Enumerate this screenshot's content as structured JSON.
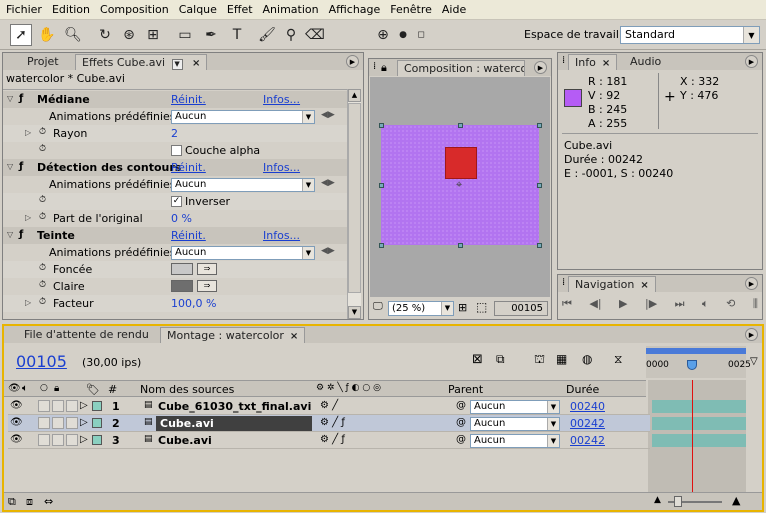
{
  "menu": [
    "Fichier",
    "Edition",
    "Composition",
    "Calque",
    "Effet",
    "Animation",
    "Affichage",
    "Fenêtre",
    "Aide"
  ],
  "workspace": {
    "label": "Espace de travail :",
    "value": "Standard"
  },
  "effects_panel": {
    "tab_project": "Projet",
    "tab_effects": "Effets Cube.avi",
    "subtitle": "watercolor * Cube.avi",
    "reinit": "Réinit.",
    "infos": "Infos...",
    "presets_label": "Animations prédéfinies :",
    "presets_value": "Aucun",
    "effects": [
      {
        "name": "Médiane",
        "params": [
          {
            "label": "Rayon",
            "value": "2"
          },
          {
            "label": "",
            "checkbox": "Couche alpha",
            "checked": false
          }
        ]
      },
      {
        "name": "Détection des contours",
        "params": [
          {
            "label": "",
            "checkbox": "Inverser",
            "checked": true
          },
          {
            "label": "Part de l'original",
            "value": "0 %"
          }
        ]
      },
      {
        "name": "Teinte",
        "params": [
          {
            "label": "Foncée",
            "color": "#c8c8c8"
          },
          {
            "label": "Claire",
            "color": "#6e6e6e"
          },
          {
            "label": "Facteur",
            "value": "100,0 %"
          }
        ]
      }
    ]
  },
  "composition_panel": {
    "tab": "Composition : watercolor",
    "zoom": "(25 %)",
    "frame": "00105",
    "canvas_color": "#b274f0",
    "square_color": "#d82a2a"
  },
  "info_panel": {
    "tab_info": "Info",
    "tab_audio": "Audio",
    "swatch_color": "#b55cf5",
    "r": "R : 181",
    "v": "V : 92",
    "b": "B : 245",
    "a": "A : 255",
    "x": "X : 332",
    "y": "Y : 476",
    "file": "Cube.avi",
    "duration": "Durée : 00242",
    "range": "E : -0001, S : 00240"
  },
  "navigation_panel": {
    "tab": "Navigation"
  },
  "timeline": {
    "tab_render": "File d'attente de rendu",
    "tab_montage": "Montage : watercolor",
    "timecode": "00105",
    "fps": "(30,00 ips)",
    "col_hash": "#",
    "col_sources": "Nom des sources",
    "col_parent": "Parent",
    "col_duration": "Durée",
    "ruler_start": "0000",
    "ruler_end": "0025",
    "layers": [
      {
        "num": "1",
        "name": "Cube_61030_txt_final.avi",
        "parent": "Aucun",
        "duration": "00240",
        "selected": false,
        "bold": true
      },
      {
        "num": "2",
        "name": "Cube.avi",
        "parent": "Aucun",
        "duration": "00242",
        "selected": true,
        "bold": true
      },
      {
        "num": "3",
        "name": "Cube.avi",
        "parent": "Aucun",
        "duration": "00242",
        "selected": false,
        "bold": true
      }
    ]
  }
}
